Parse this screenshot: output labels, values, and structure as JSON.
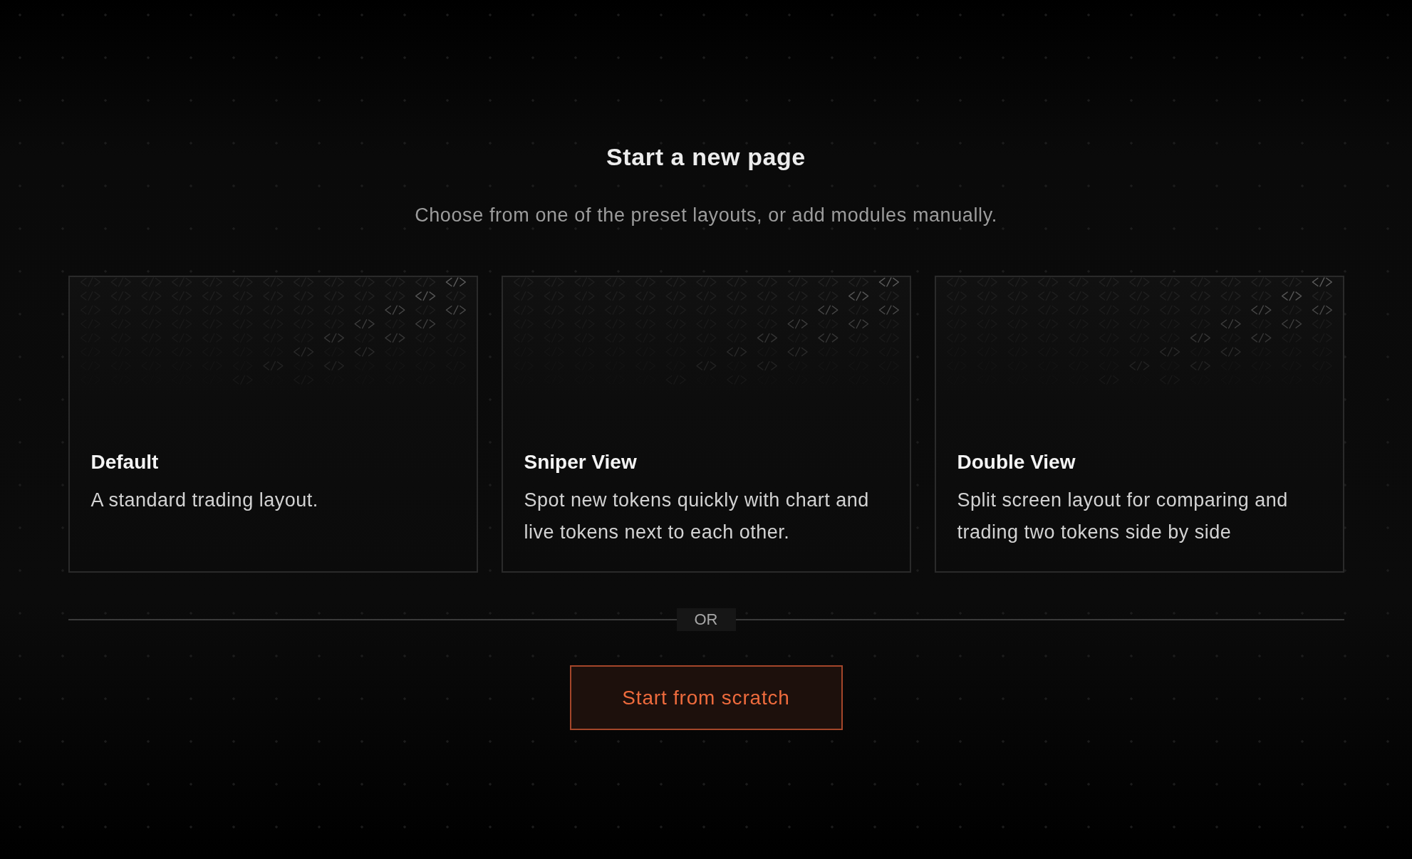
{
  "header": {
    "title": "Start a new page",
    "subtitle": "Choose from one of the preset layouts, or add modules manually."
  },
  "layouts": [
    {
      "name": "Default",
      "description": "A standard trading layout."
    },
    {
      "name": "Sniper View",
      "description": "Spot new tokens quickly with chart and live tokens next to each other."
    },
    {
      "name": "Double View",
      "description": "Split screen layout for comparing and trading two tokens side by side"
    }
  ],
  "divider": {
    "label": "OR"
  },
  "primary_button": {
    "label": "Start from scratch"
  }
}
